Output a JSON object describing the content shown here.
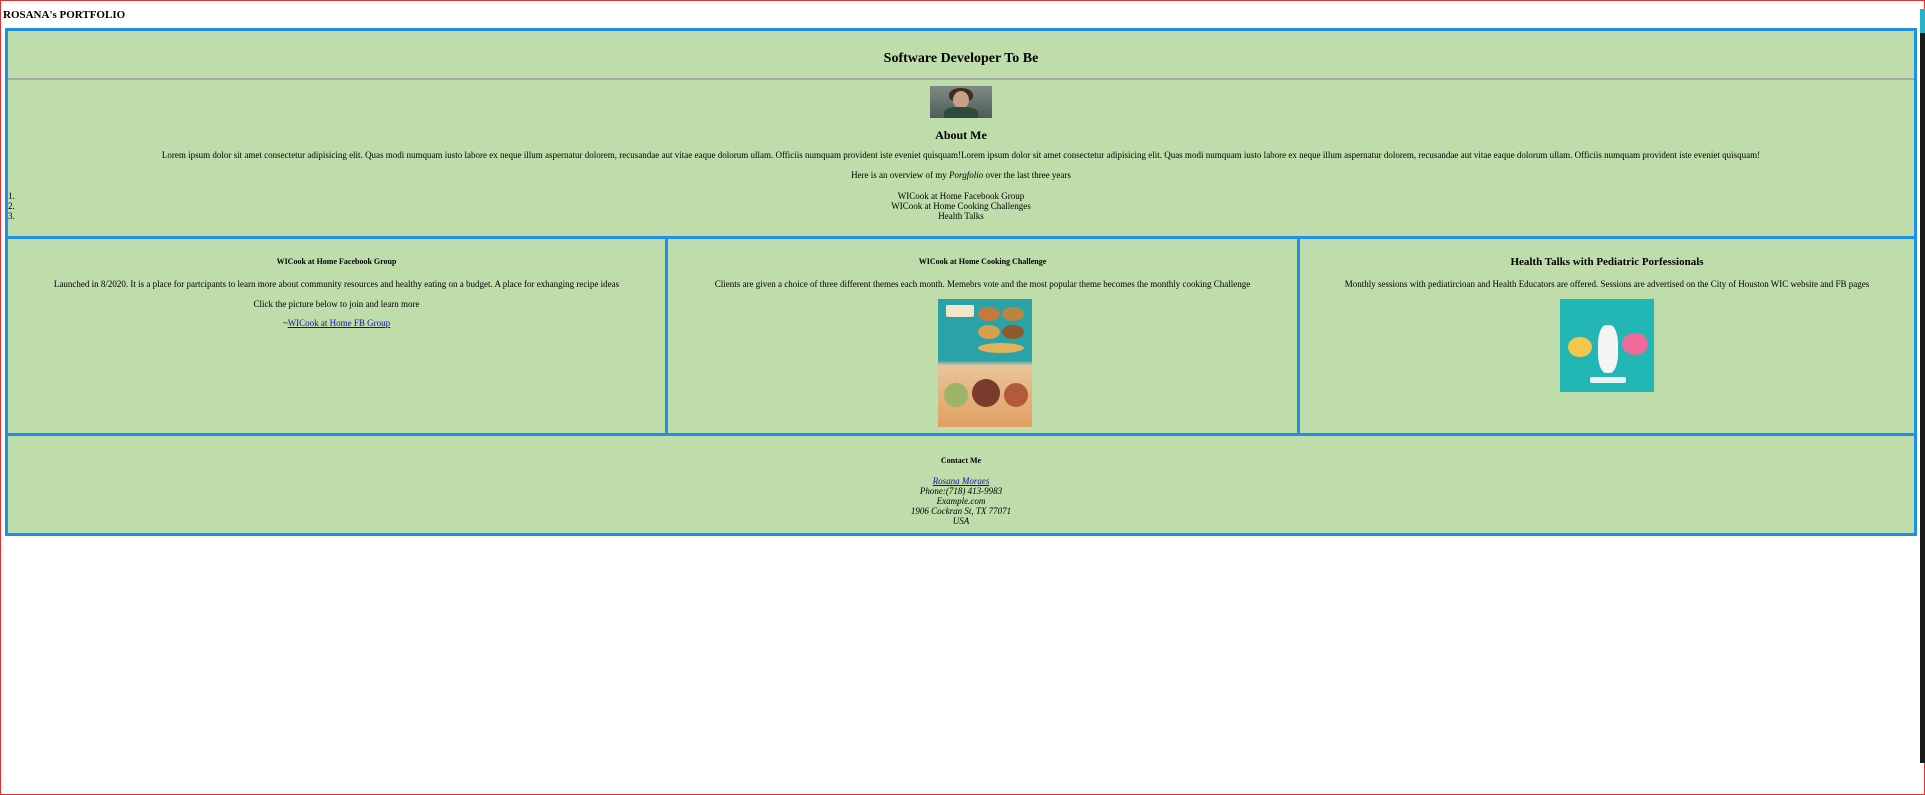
{
  "site_title": "ROSANA's PORTFOLIO",
  "header": {
    "title": "Software Developer To Be"
  },
  "about": {
    "heading": "About Me",
    "lorem": "Lorem ipsum dolor sit amet consectetur adipisicing elit. Quas modi numquam iusto labore ex neque illum aspernatur dolorem, recusandae aut vitae eaque dolorum ullam. Officiis numquam provident iste eveniet quisquam!Lorem ipsum dolor sit amet consectetur adipisicing elit. Quas modi numquam iusto labore ex neque illum aspernatur dolorem, recusandae aut vitae eaque dolorum ullam. Officiis numquam provident iste eveniet quisquam!",
    "overview_before": "Here is an overview of my ",
    "overview_em": "Porgfolio",
    "overview_after": " over the last three years",
    "list": [
      {
        "num": "1.",
        "label": "WICook at Home Facebook Group"
      },
      {
        "num": "2.",
        "label": "WICook at Home Cooking Challenges"
      },
      {
        "num": "3.",
        "label": "Health Talks"
      }
    ]
  },
  "cards": {
    "fb": {
      "title": "WICook at Home Facebook Group",
      "desc": "Launched in 8/2020. It is a place for partcipants to learn more about community resources and healthy eating on a budget. A place for exhanging recipe ideas",
      "cta": "Click the picture below to join and learn more",
      "link_prefix": "~",
      "link_text": "WICook at Home FB Group"
    },
    "challenge": {
      "title": "WICook at Home Cooking Challenge",
      "desc": "Clients are given a choice of three different themes each month. Memebrs vote and the most popular theme becomes the monthly cooking Challenge"
    },
    "health": {
      "title": "Health Talks with Pediatric Porfessionals",
      "desc": "Monthly sessions with pediatircioan and Health Educators are offered. Sessions are advertised on the City of Houston WIC website and FB pages"
    }
  },
  "contact": {
    "heading": "Contact Me",
    "name": "Rosana Moraes",
    "phone": "Phone:(718) 413-9983",
    "email": "Example.com",
    "street": "1906 Cockran St, TX 77071",
    "country": "USA"
  },
  "colors": {
    "panel": "#bfddab",
    "border": "#1e90e6",
    "link": "#1a0dab"
  }
}
